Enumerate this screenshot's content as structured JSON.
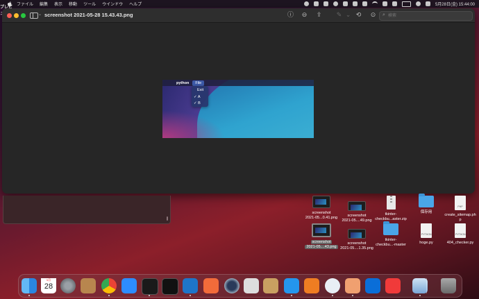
{
  "menubar": {
    "app_name": "プレビュー",
    "items": [
      "ファイル",
      "編集",
      "表示",
      "移動",
      "ツール",
      "ウインドウ",
      "ヘルプ"
    ],
    "datetime": "5月28日(金) 15:44:00"
  },
  "window": {
    "title": "screenshot 2021-05-28 15.43.43.png",
    "search_placeholder": "検索"
  },
  "embedded": {
    "app_label": "python",
    "file_menu": "File",
    "menu_items": [
      "Exit",
      "A",
      "B"
    ],
    "checked": [
      "A",
      "B"
    ]
  },
  "desktop": {
    "files": [
      {
        "line1": "screenshot",
        "line2": "2021-05...0.41.png",
        "kind": "screenshot"
      },
      {
        "line1": "screenshot",
        "line2": "2021-05....49.png",
        "kind": "screenshot-wide"
      },
      {
        "line1": "tkinter-",
        "line2": "checkbu...aster.zip",
        "kind": "zip"
      },
      {
        "line1": "保存用",
        "line2": "",
        "kind": "folder"
      },
      {
        "line1": "create_sitemap.ph",
        "line2": "p",
        "kind": "php"
      },
      {
        "line1": "screenshot",
        "line2": "2021-05....43.png",
        "kind": "screenshot-selected"
      },
      {
        "line1": "screenshot",
        "line2": "2021-05....1.35.png",
        "kind": "screenshot-wide"
      },
      {
        "line1": "tkinter-",
        "line2": "checkbu...-master",
        "kind": "folder"
      },
      {
        "line1": "hoge.py",
        "line2": "",
        "kind": "python"
      },
      {
        "line1": "404_checker.py",
        "line2": "",
        "kind": "python"
      }
    ]
  },
  "dock": {
    "calendar_month": "5月",
    "calendar_day": "28",
    "apps": [
      "finder-icon",
      "calendar-icon",
      "system-preferences-icon",
      "contacts-icon",
      "chrome-icon",
      "zoom-icon",
      "terminal-icon",
      "terminal-2-icon",
      "vscode-icon",
      "safari-icon",
      "quicktime-icon",
      "sequel-icon",
      "archive-icon",
      "docker-icon",
      "sourcetree-icon",
      "privacy-icon",
      "photo-icon",
      "infinity-icon",
      "clock-icon",
      "preview-icon",
      "trash-icon"
    ]
  },
  "colors": {
    "accent_red": "#fe5f57",
    "accent_yellow": "#febc2e",
    "accent_green": "#28c840"
  }
}
